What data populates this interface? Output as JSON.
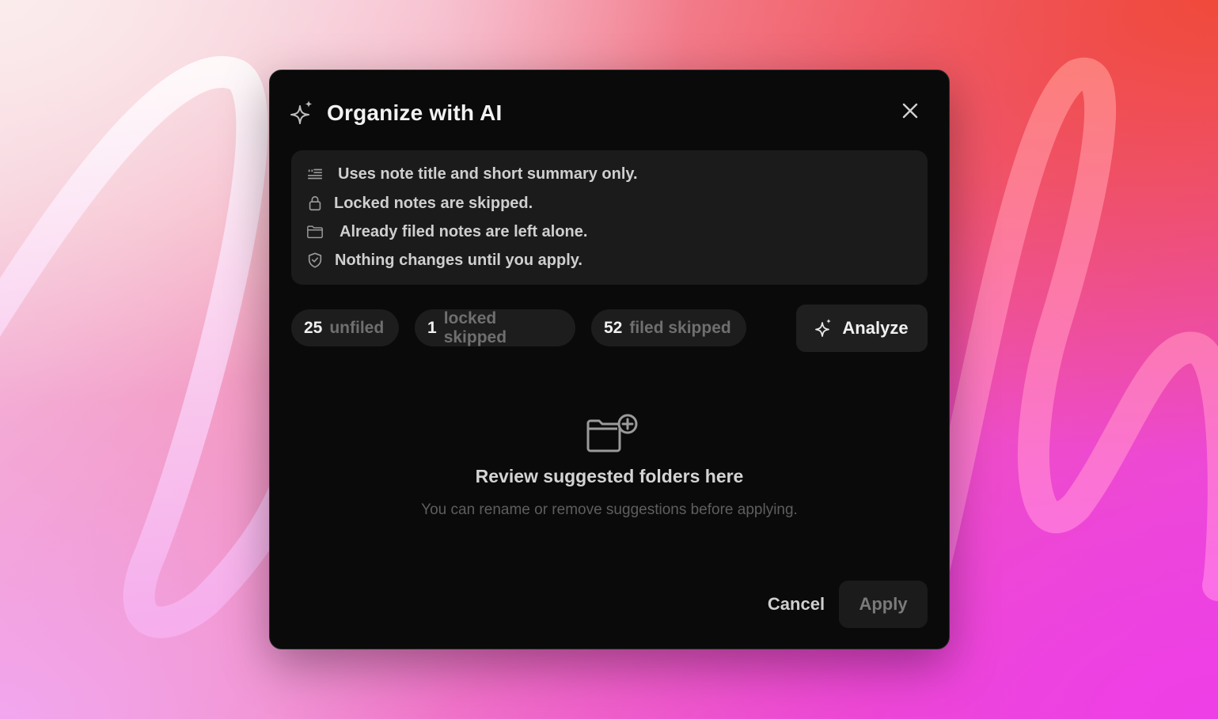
{
  "dialog": {
    "title": "Organize with AI",
    "close_label": "Close"
  },
  "info": {
    "items": [
      {
        "icon": "summary-icon",
        "text": "Uses note title and short summary only."
      },
      {
        "icon": "lock-icon",
        "text": "Locked notes are skipped."
      },
      {
        "icon": "folder-icon",
        "text": "Already filed notes are left alone."
      },
      {
        "icon": "shield-check-icon",
        "text": "Nothing changes until you apply."
      }
    ]
  },
  "stats": [
    {
      "count": "25",
      "label": "unfiled"
    },
    {
      "count": "1",
      "label": "locked skipped"
    },
    {
      "count": "52",
      "label": "filed skipped"
    }
  ],
  "analyze": {
    "label": "Analyze",
    "icon": "sparkle-icon"
  },
  "empty_state": {
    "icon": "folder-plus-icon",
    "title": "Review suggested folders here",
    "subtitle": "You can rename or remove suggestions before applying."
  },
  "footer": {
    "cancel_label": "Cancel",
    "apply_label": "Apply"
  }
}
